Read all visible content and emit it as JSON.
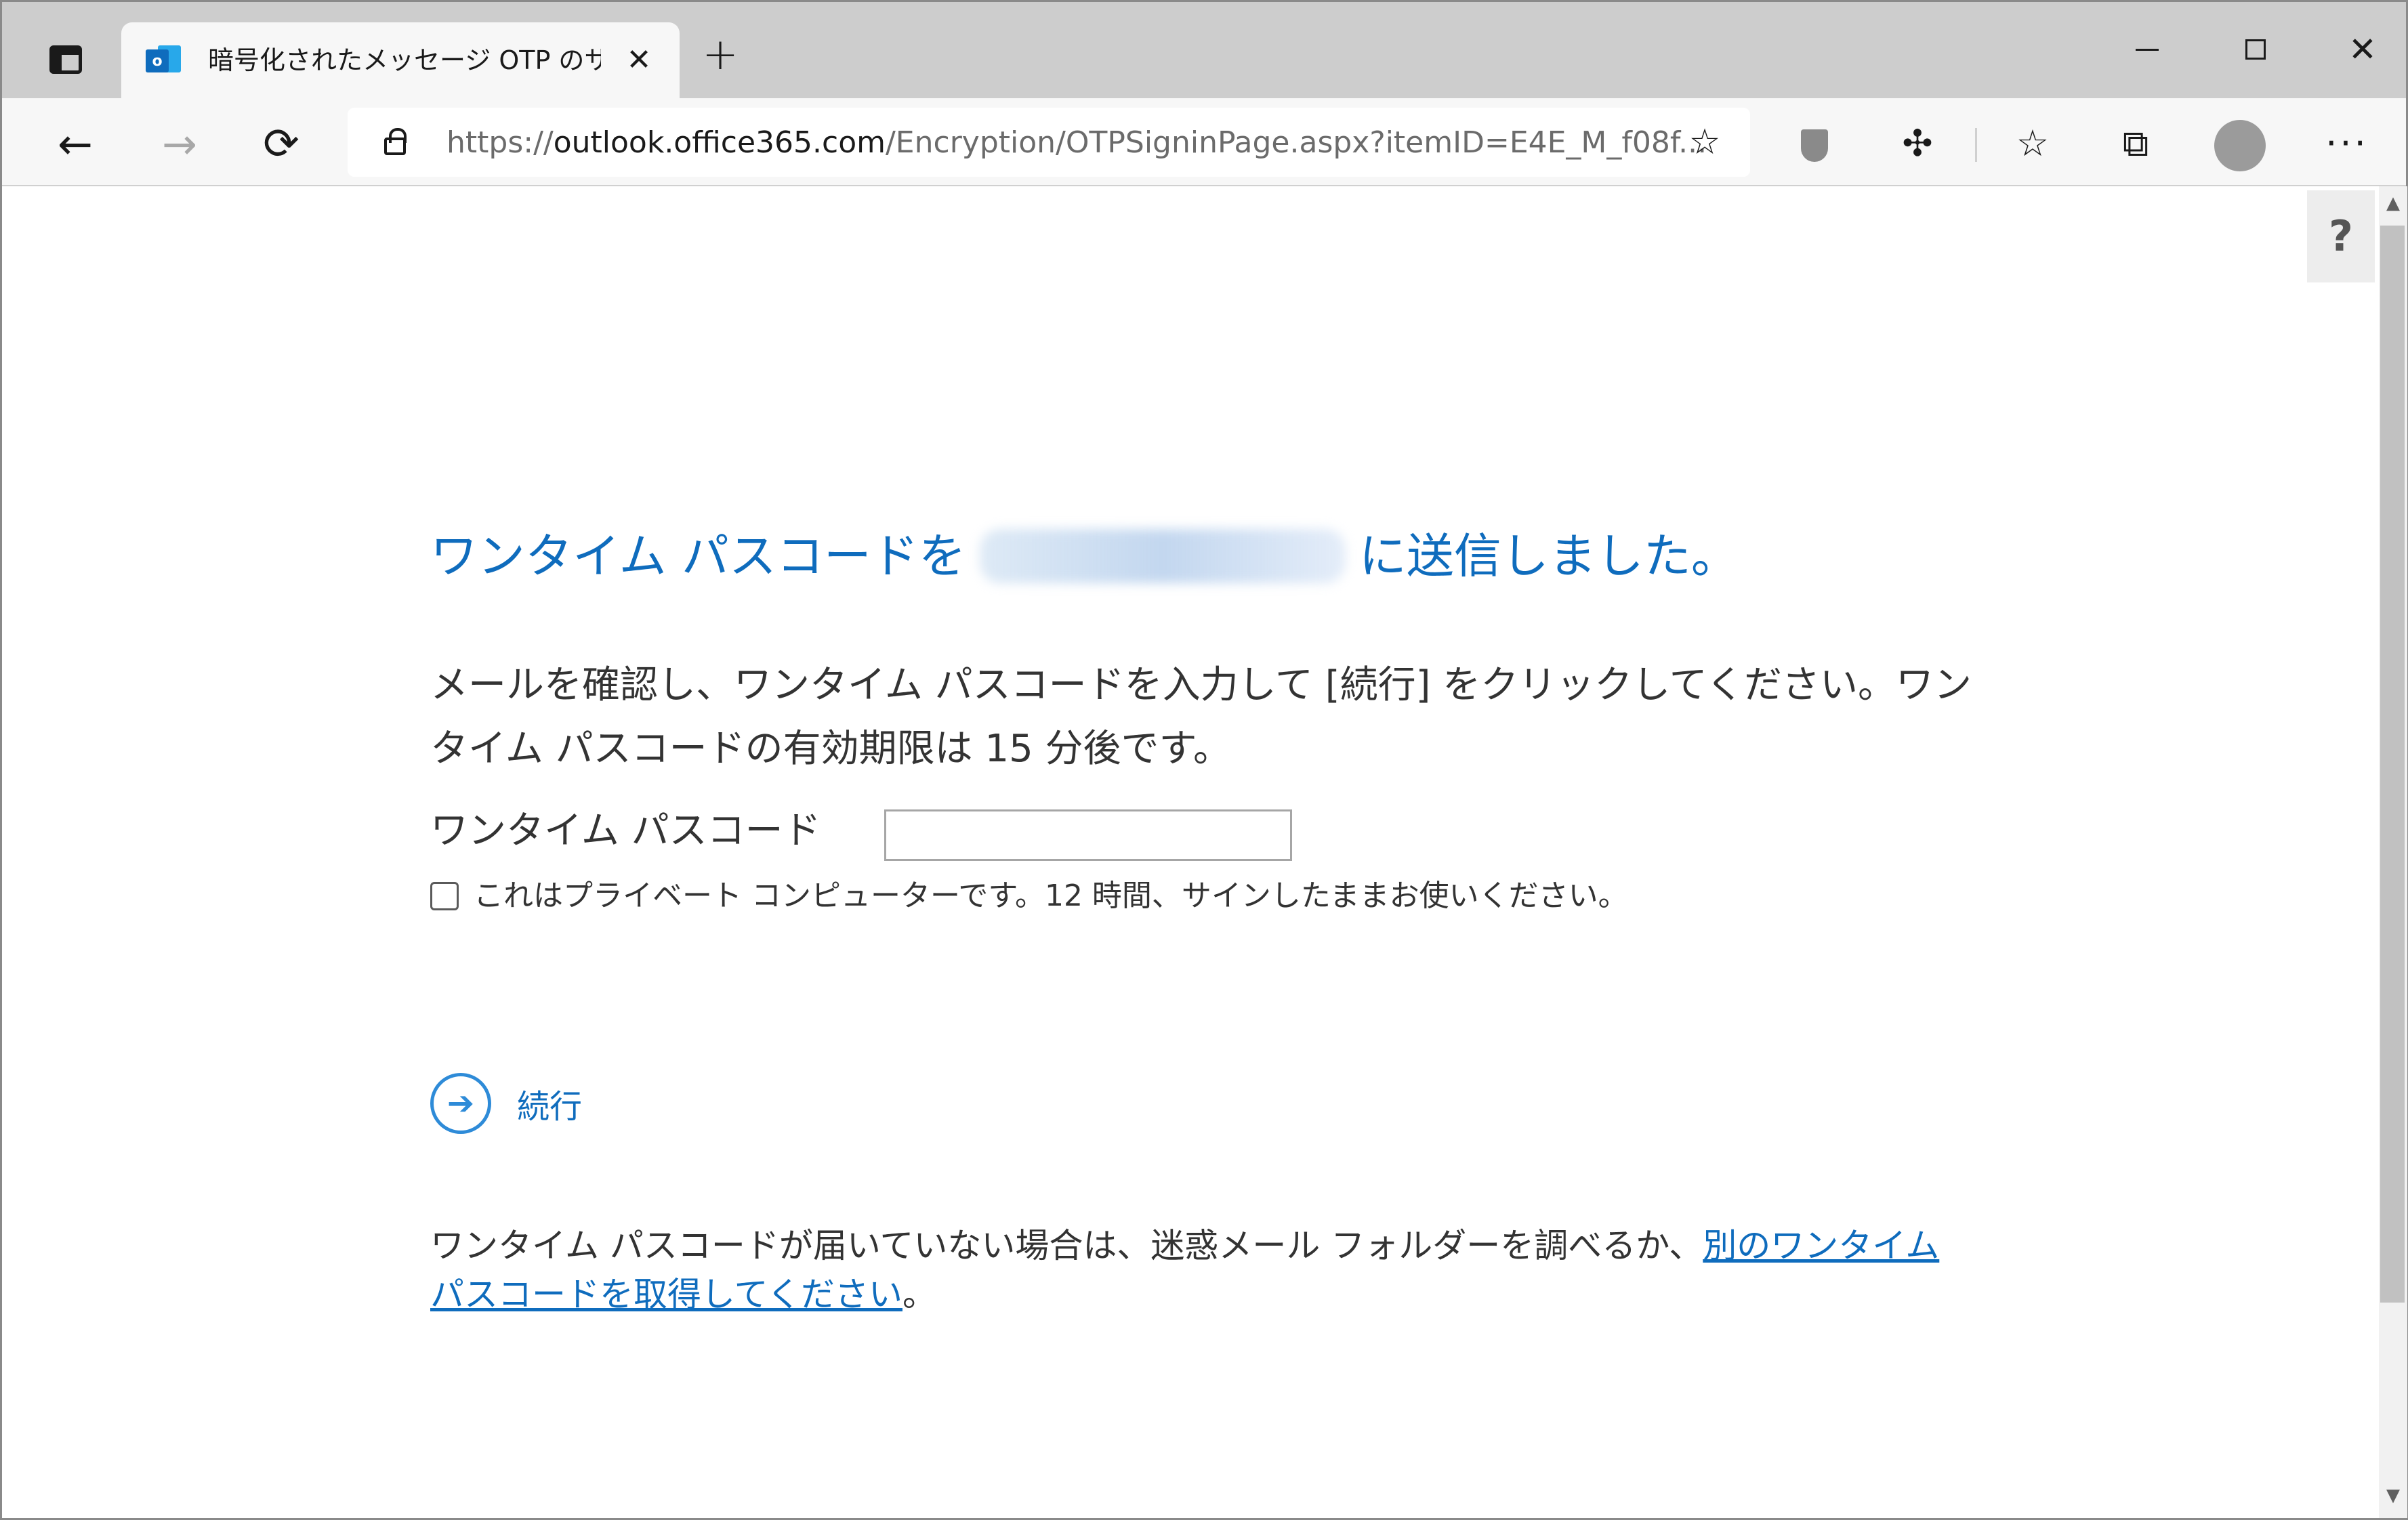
{
  "browser": {
    "tab": {
      "favicon_text": "o",
      "title": "暗号化されたメッセージ OTP のサイン"
    },
    "address": {
      "scheme": "https://",
      "host": "outlook.office365.com",
      "path": "/Encryption/OTPSigninPage.aspx?itemID=E4E_M_f08f..."
    },
    "icons": {
      "tab_actions": "tab-actions-icon",
      "new_tab": "+",
      "close_tab": "✕",
      "minimize": "minimize-icon",
      "maximize": "maximize-icon",
      "close_window": "✕",
      "back": "←",
      "forward": "→",
      "refresh": "⟳",
      "add_favorite": "☆",
      "extensions": "✣",
      "favorites": "☆",
      "collections": "⧉",
      "more": "···"
    }
  },
  "page": {
    "help": "?",
    "heading_prefix": "ワンタイム パスコードを",
    "heading_suffix": "に送信しました。",
    "instructions": "メールを確認し、ワンタイム パスコードを入力して [続行] をクリックしてください。ワンタイム パスコードの有効期限は 15 分後です。",
    "otp_label": "ワンタイム パスコード",
    "otp_value": "",
    "private_label": "これはプライベート コンピューターです。12 時間、サインしたままお使いください。",
    "continue_label": "続行",
    "continue_icon": "➔",
    "footer_text": "ワンタイム パスコードが届いていない場合は、迷惑メール フォルダーを調べるか、",
    "footer_link": "別のワンタイム パスコードを取得してください",
    "footer_end": "。"
  },
  "colors": {
    "accent": "#0f6cbd",
    "continue_ring": "#2e8bd8",
    "tabstrip": "#cdcdcd"
  }
}
